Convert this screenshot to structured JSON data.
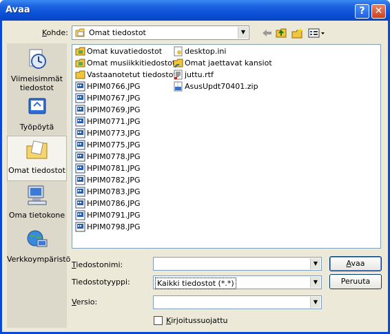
{
  "window": {
    "title": "Avaa"
  },
  "lookin": {
    "label": "Kohde:",
    "value": "Omat tiedostot"
  },
  "places": [
    {
      "label": "Viimeisimmät tiedostot",
      "icon": "recent-documents-icon"
    },
    {
      "label": "Työpöytä",
      "icon": "desktop-icon"
    },
    {
      "label": "Omat tiedostot",
      "icon": "my-documents-icon",
      "selected": true
    },
    {
      "label": "Oma tietokone",
      "icon": "my-computer-icon"
    },
    {
      "label": "Verkkoympäristö",
      "icon": "network-places-icon"
    }
  ],
  "files_col1": [
    {
      "name": "Omat kuvatiedostot",
      "type": "special-folder"
    },
    {
      "name": "Omat musiikkitiedostot",
      "type": "special-folder"
    },
    {
      "name": "Vastaanotetut tiedostot",
      "type": "folder"
    },
    {
      "name": "HPIM0766.JPG",
      "type": "jpg"
    },
    {
      "name": "HPIM0767.JPG",
      "type": "jpg"
    },
    {
      "name": "HPIM0769.JPG",
      "type": "jpg"
    },
    {
      "name": "HPIM0771.JPG",
      "type": "jpg"
    },
    {
      "name": "HPIM0773.JPG",
      "type": "jpg"
    },
    {
      "name": "HPIM0775.JPG",
      "type": "jpg"
    },
    {
      "name": "HPIM0778.JPG",
      "type": "jpg"
    },
    {
      "name": "HPIM0781.JPG",
      "type": "jpg"
    },
    {
      "name": "HPIM0782.JPG",
      "type": "jpg"
    },
    {
      "name": "HPIM0783.JPG",
      "type": "jpg"
    },
    {
      "name": "HPIM0786.JPG",
      "type": "jpg"
    },
    {
      "name": "HPIM0791.JPG",
      "type": "jpg"
    },
    {
      "name": "HPIM0798.JPG",
      "type": "jpg"
    }
  ],
  "files_col2": [
    {
      "name": "desktop.ini",
      "type": "ini"
    },
    {
      "name": "Omat jaettavat kansiot",
      "type": "shared-folder"
    },
    {
      "name": "juttu.rtf",
      "type": "rtf"
    },
    {
      "name": "AsusUpdt70401.zip",
      "type": "zip"
    }
  ],
  "filename": {
    "label_prefix": "",
    "label_u": "T",
    "label_rest": "iedostonimi:",
    "value": ""
  },
  "filetype": {
    "label": "Tiedostotyyppi:",
    "value": "Kaikki tiedostot (*.*)"
  },
  "version": {
    "label_u": "V",
    "label_rest": "ersio:",
    "value": ""
  },
  "readonly": {
    "label_u": "K",
    "label_rest": "irjoitussuojattu",
    "checked": false
  },
  "buttons": {
    "open_u": "A",
    "open_rest": "vaa",
    "cancel": "Peruuta"
  }
}
